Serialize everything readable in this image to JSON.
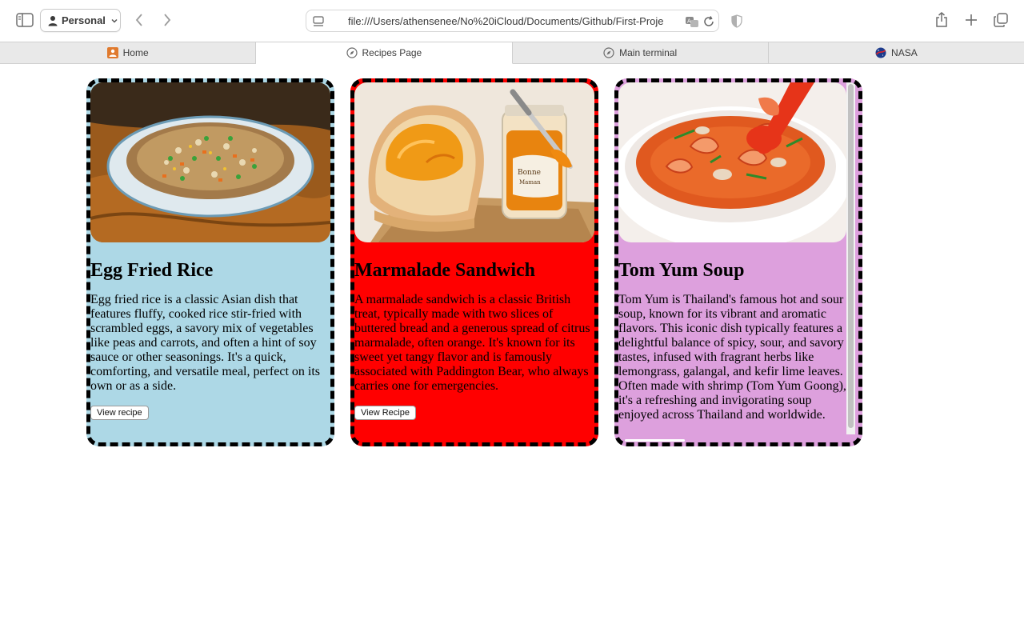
{
  "browser": {
    "profile_label": "Personal",
    "url": "file:///Users/athensenee/No%20iCloud/Documents/Github/First-Proje",
    "tabs": [
      {
        "label": "Home",
        "icon": "home-tab-icon",
        "active": false
      },
      {
        "label": "Recipes Page",
        "icon": "compass-icon",
        "active": true
      },
      {
        "label": "Main terminal",
        "icon": "compass-icon",
        "active": false
      },
      {
        "label": "NASA",
        "icon": "nasa-logo-icon",
        "active": false
      }
    ]
  },
  "cards": [
    {
      "title": "Egg Fried Rice",
      "description": "Egg fried rice is a classic Asian dish that features fluffy, cooked rice stir-fried with scrambled eggs, a savory mix of vegetables like peas and carrots, and often a hint of soy sauce or other seasonings. It's a quick, comforting, and versatile meal, perfect on its own or as a side.",
      "button_label": "View recipe",
      "background": "#add8e6"
    },
    {
      "title": "Marmalade Sandwich",
      "description": "A marmalade sandwich is a classic British treat, typically made with two slices of buttered bread and a generous spread of citrus marmalade, often orange. It's known for its sweet yet tangy flavor and is famously associated with Paddington Bear, who always carries one for emergencies.",
      "button_label": "View Recipe",
      "background": "#ff0000"
    },
    {
      "title": "Tom Yum Soup",
      "description": "Tom Yum is Thailand's famous hot and sour soup, known for its vibrant and aromatic flavors. This iconic dish typically features a delightful balance of spicy, sour, and savory tastes, infused with fragrant herbs like lemongrass, galangal, and kefir lime leaves. Often made with shrimp (Tom Yum Goong), it's a refreshing and invigorating soup enjoyed across Thailand and worldwide.",
      "background": "#dda0dd"
    }
  ]
}
